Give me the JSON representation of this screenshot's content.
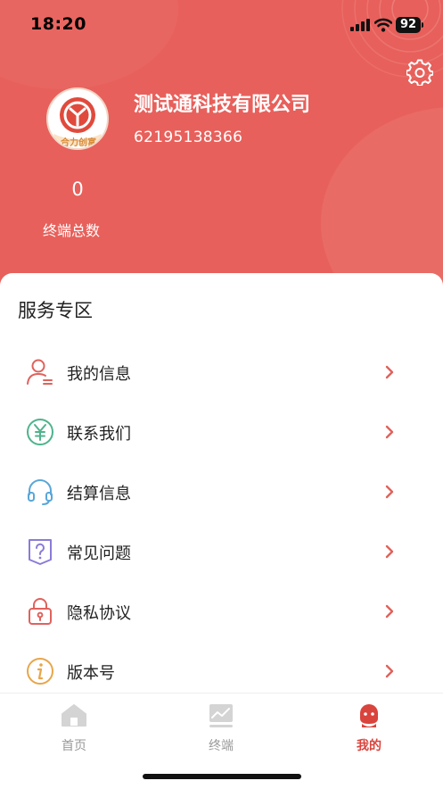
{
  "status_bar": {
    "time": "18:20",
    "battery": "92"
  },
  "colors": {
    "header_bg": "#e8605b",
    "accent": "#d9443d"
  },
  "profile": {
    "company_name": "测试通科技有限公司",
    "phone": "62195138366",
    "avatar_text": "合力创富"
  },
  "stats": {
    "value": "0",
    "label": "终端总数"
  },
  "service": {
    "title": "服务专区",
    "items": [
      {
        "label": "我的信息",
        "icon": "user-icon"
      },
      {
        "label": "联系我们",
        "icon": "yen-icon"
      },
      {
        "label": "结算信息",
        "icon": "headset-icon"
      },
      {
        "label": "常见问题",
        "icon": "question-icon"
      },
      {
        "label": "隐私协议",
        "icon": "lock-icon"
      },
      {
        "label": "版本号",
        "icon": "info-icon"
      }
    ]
  },
  "tabbar": {
    "tabs": [
      {
        "label": "首页",
        "icon": "home-icon",
        "active": false
      },
      {
        "label": "终端",
        "icon": "chart-icon",
        "active": false
      },
      {
        "label": "我的",
        "icon": "profile-icon",
        "active": true
      }
    ]
  }
}
